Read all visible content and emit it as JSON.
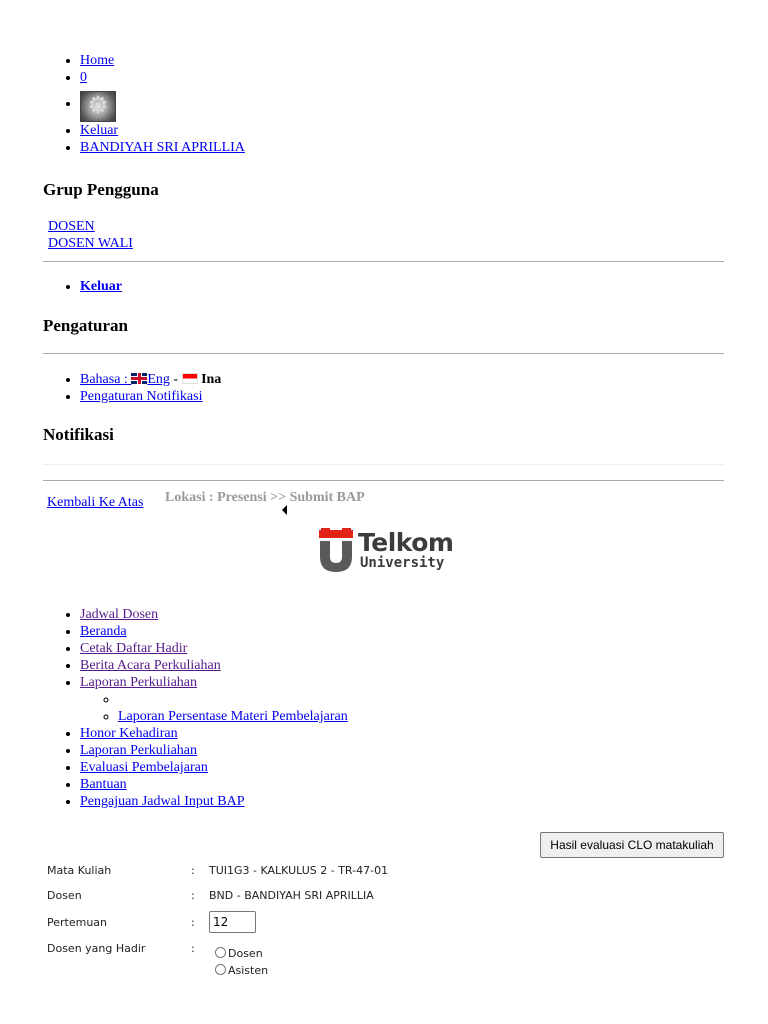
{
  "top_nav": {
    "home": "Home",
    "count": "0",
    "keluar": "Keluar",
    "user": "BANDIYAH SRI APRILLIA"
  },
  "grup_pengguna": {
    "title": "Grup Pengguna",
    "items": [
      "DOSEN",
      "DOSEN WALI"
    ]
  },
  "keluar_bold": "Keluar",
  "pengaturan": {
    "title": "Pengaturan",
    "bahasa_label": "Bahasa :",
    "eng": "Eng",
    "sep": "-",
    "ina": "Ina",
    "notifikasi_link": "Pengaturan Notifikasi"
  },
  "notifikasi": {
    "title": "Notifikasi"
  },
  "back_to_top": "Kembali Ke Atas",
  "lokasi": "Lokasi : Presensi >> Submit BAP",
  "logo": {
    "name": "Telkom",
    "sub": "University"
  },
  "menu": {
    "items": [
      "Jadwal Dosen",
      "Beranda",
      "Cetak Daftar Hadir",
      "Berita Acara Perkuliahan",
      "Laporan Perkuliahan"
    ],
    "sub_item": "Laporan Persentase Materi Pembelajaran",
    "items2": [
      "Honor Kehadiran",
      "Laporan Perkuliahan",
      "Evaluasi Pembelajaran",
      "Bantuan",
      "Pengajuan Jadwal Input BAP"
    ]
  },
  "clo_button": "Hasil evaluasi CLO matakuliah",
  "form": {
    "mata_kuliah_label": "Mata Kuliah",
    "mata_kuliah_value": "TUI1G3 - KALKULUS 2 - TR-47-01",
    "dosen_label": "Dosen",
    "dosen_value": "BND - BANDIYAH SRI APRILLIA",
    "pertemuan_label": "Pertemuan",
    "pertemuan_value": "12",
    "hadir_label": "Dosen yang Hadir",
    "colon": ":",
    "opt_dosen": "Dosen",
    "opt_asisten": "Asisten"
  },
  "colors": {
    "link": "#0000ee",
    "visited": "#551a8b",
    "telkom_red": "#e2231a",
    "telkom_grey": "#5a5a5a",
    "lokasi": "#9a9a9a"
  }
}
